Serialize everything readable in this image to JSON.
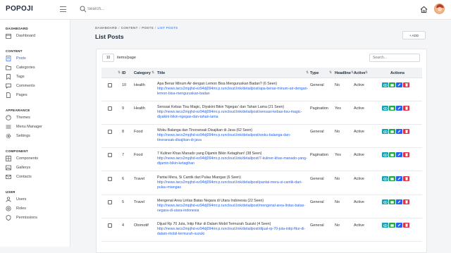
{
  "app": {
    "logo": "POPOJI"
  },
  "search": {
    "placeholder": "Search..."
  },
  "sidebar": {
    "sections": [
      {
        "title": "DASHBOARD",
        "items": [
          {
            "label": "Dashboard",
            "icon": "calendar-icon"
          }
        ]
      },
      {
        "title": "CONTENT",
        "items": [
          {
            "label": "Posts",
            "icon": "posts-icon",
            "active": true
          },
          {
            "label": "Categories",
            "icon": "folder-icon"
          },
          {
            "label": "Tags",
            "icon": "tag-icon"
          },
          {
            "label": "Comments",
            "icon": "comment-icon"
          },
          {
            "label": "Pages",
            "icon": "pages-icon"
          }
        ]
      },
      {
        "title": "APPEARANCE",
        "items": [
          {
            "label": "Themes",
            "icon": "theme-icon"
          },
          {
            "label": "Menu Manager",
            "icon": "menu-icon"
          },
          {
            "label": "Settings",
            "icon": "gear-icon"
          }
        ]
      },
      {
        "title": "COMPONENT",
        "items": [
          {
            "label": "Components",
            "icon": "components-icon"
          },
          {
            "label": "Gallerys",
            "icon": "gallery-icon"
          },
          {
            "label": "Contacts",
            "icon": "contact-icon"
          }
        ]
      },
      {
        "title": "USER",
        "items": [
          {
            "label": "Users",
            "icon": "user-icon"
          },
          {
            "label": "Roles",
            "icon": "roles-icon"
          },
          {
            "label": "Permissions",
            "icon": "shield-icon"
          }
        ]
      }
    ]
  },
  "breadcrumb": {
    "items": [
      "DASHBOARD",
      "CONTENT",
      "POSTS"
    ],
    "current": "LIST POSTS",
    "separator": "/"
  },
  "page": {
    "title": "List Posts",
    "add_label": "+ ADD"
  },
  "table": {
    "page_size": "10",
    "page_size_label": "items/page",
    "search_placeholder": "Search...",
    "headers": {
      "id": "ID",
      "category": "Category",
      "title": "Title",
      "type": "Type",
      "headline": "Headline",
      "active": "Active",
      "actions": "Actions"
    },
    "rows": [
      {
        "id": "10",
        "category": "Health",
        "title": "Apa Benar Minum Air dengan Lemon Bisa Menguruskan Badan? (6 Seen)",
        "url": "http://news.iwcs2mpjhd-ez94dj094mr.p.runcloud.link/detailpost/apa-benar-minum-air-dengan-lemon-bisa-menguruskan-badan",
        "type": "General",
        "headline": "No",
        "active": "Active"
      },
      {
        "id": "9",
        "category": "Health",
        "title": "Sensasi Kebas Tisu Magic, Diyakini Bikin 'Ngegas' dan Tahan Lama (21 Seen)",
        "url": "http://news.iwcs2mpjhd-ez94dj094mr.p.runcloud.link/detailpost/sensasi-kebas-tisu-magic-diyakini-bikin-ngegas-dan-tahan-lama",
        "type": "Pagination",
        "headline": "Yes",
        "active": "Active"
      },
      {
        "id": "8",
        "category": "Food",
        "title": "Woku Balanga dan Tinoransak Disajikan di Java (62 Seen)",
        "url": "http://news.iwcs2mpjhd-ez94dj094mr.p.runcloud.link/detailpost/woku-balanga-dan-tinoransak-disajikan-di-java",
        "type": "General",
        "headline": "No",
        "active": "Active"
      },
      {
        "id": "7",
        "category": "Food",
        "title": "7 Kuliner Khas Manado yang Dijamin Bikin Ketagihan! (38 Seen)",
        "url": "http://news.iwcs2mpjhd-ez94dj094mr.p.runcloud.link/detailpost/7-kuliner-khas-manado-yang-dijamin-bikin-ketagihan",
        "type": "Pagination",
        "headline": "Yes",
        "active": "Active"
      },
      {
        "id": "6",
        "category": "Travel",
        "title": "Pantai Mera, Si Cantik dari Pulau Miangas (6 Seen)",
        "url": "http://news.iwcs2mpjhd-ez94dj094mr.p.runcloud.link/detailpost/pantai-mera-si-cantik-dari-pulau-miangas",
        "type": "General",
        "headline": "No",
        "active": "Active"
      },
      {
        "id": "5",
        "category": "Travel",
        "title": "Mengenal Area Lintas Batas Negara di Utara Indonesia (22 Seen)",
        "url": "http://news.iwcs2mpjhd-ez94dj094mr.p.runcloud.link/detailpost/mengenal-area-lintas-batas-negara-di-utara-indonesia",
        "type": "General",
        "headline": "No",
        "active": "Active"
      },
      {
        "id": "4",
        "category": "Otomotif",
        "title": "Dijual Rp 70 Juta, Intip Fitur di Dalam Mobil Termurah Suzuki (4 Seen)",
        "url": "http://news.iwcs2mpjhd-ez94dj094mr.p.runcloud.link/detailpost/dijual-rp-70-juta-intip-fitur-di-dalam-mobil-termurah-suzuki",
        "type": "General",
        "headline": "No",
        "active": "Active"
      }
    ]
  },
  "colors": {
    "accent": "#2563eb",
    "view": "#17a2b8",
    "message": "#28a745",
    "edit": "#2563eb",
    "delete": "#dc3545"
  }
}
